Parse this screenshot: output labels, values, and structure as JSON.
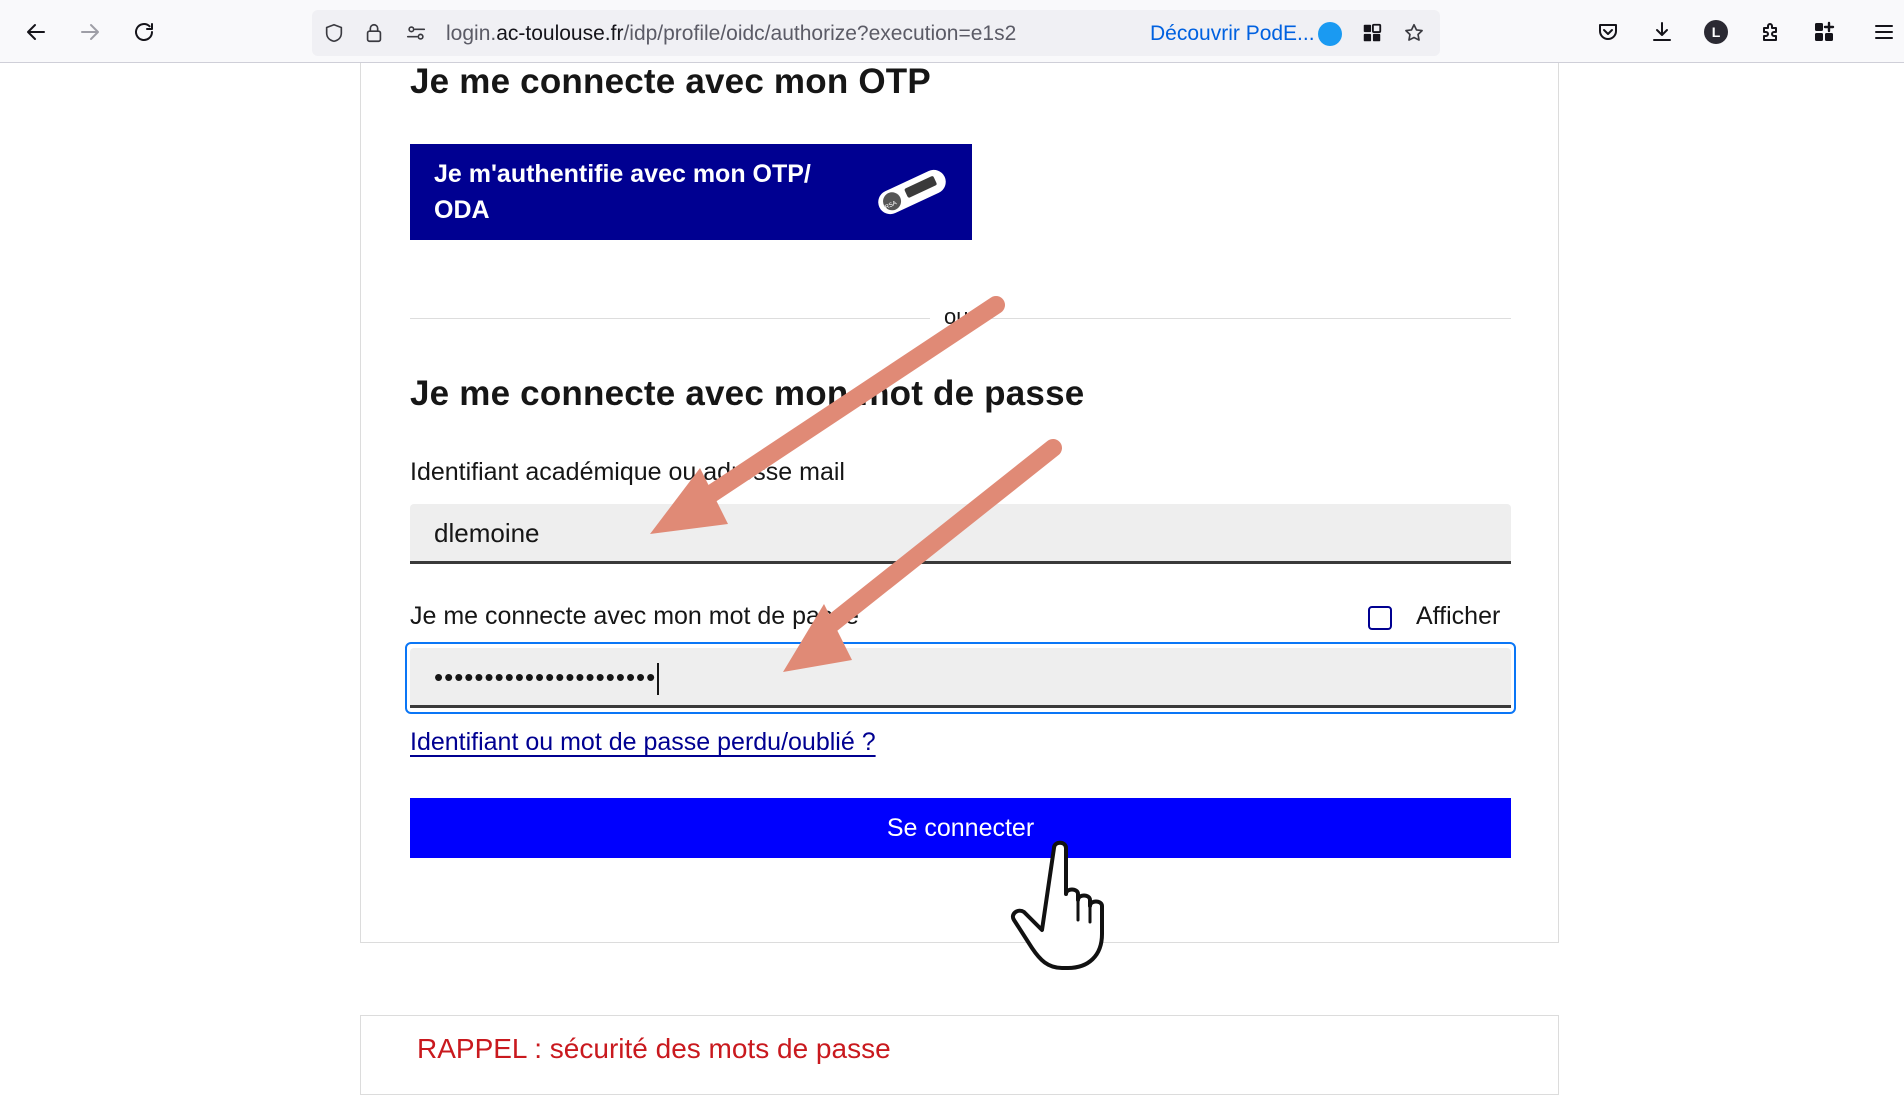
{
  "browser": {
    "url_prefix": "login.",
    "url_domain": "ac-toulouse.fr",
    "url_path": "/idp/profile/oidc/authorize?execution=e1s2",
    "promo_text": "Découvrir PodE...",
    "account_initial": "L"
  },
  "otp": {
    "heading": "Je me connecte avec mon OTP",
    "button_label": "Je m'authentifie avec mon OTP/ ODA",
    "icon_text": "RSA"
  },
  "separator": {
    "text": "ou"
  },
  "password_section": {
    "heading": "Je me connecte avec mon mot de passe",
    "username_label": "Identifiant académique ou adresse mail",
    "username_value": "dlemoine",
    "password_label": "Je me connecte avec mon mot de passe",
    "show_label": "Afficher",
    "password_mask": "••••••••••••••••••••••",
    "forgot_link": "Identifiant ou mot de passe perdu/oublié ?",
    "submit_label": "Se connecter"
  },
  "reminder": {
    "title": "RAPPEL : sécurité des mots de passe"
  },
  "colors": {
    "primary": "#000091",
    "submit": "#0000fe",
    "arrow": "#e08a76",
    "focus": "#0a76f6",
    "reminder": "#c9191e"
  }
}
